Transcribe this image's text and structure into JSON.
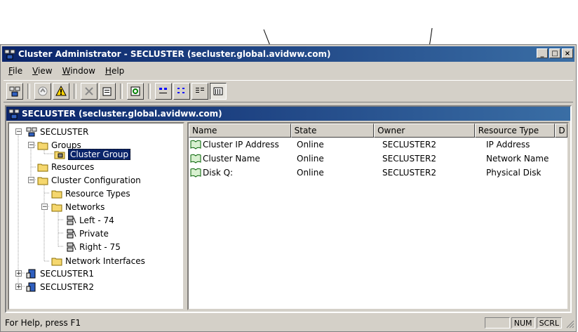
{
  "window": {
    "title": "Cluster Administrator - SECLUSTER (secluster.global.avidww.com)",
    "controls": [
      "_",
      "□",
      "×"
    ]
  },
  "menu": [
    "File",
    "View",
    "Window",
    "Help"
  ],
  "child_window": {
    "title": "SECLUSTER (secluster.global.avidww.com)"
  },
  "tree": {
    "root": "SECLUSTER",
    "groups": "Groups",
    "cluster_group": "Cluster Group",
    "resources": "Resources",
    "cluster_config": "Cluster Configuration",
    "resource_types": "Resource Types",
    "networks": "Networks",
    "left": "Left - 74",
    "private": "Private",
    "right": "Right - 75",
    "net_interfaces": "Network Interfaces",
    "node1": "SECLUSTER1",
    "node2": "SECLUSTER2"
  },
  "list": {
    "columns": [
      "Name",
      "State",
      "Owner",
      "Resource Type",
      "D"
    ],
    "rows": [
      [
        "Cluster IP Address",
        "Online",
        "SECLUSTER2",
        "IP Address"
      ],
      [
        "Cluster Name",
        "Online",
        "SECLUSTER2",
        "Network Name"
      ],
      [
        "Disk Q:",
        "Online",
        "SECLUSTER2",
        "Physical Disk"
      ]
    ]
  },
  "status": {
    "text": "For Help, press F1",
    "num": "NUM",
    "scrl": "SCRL"
  }
}
